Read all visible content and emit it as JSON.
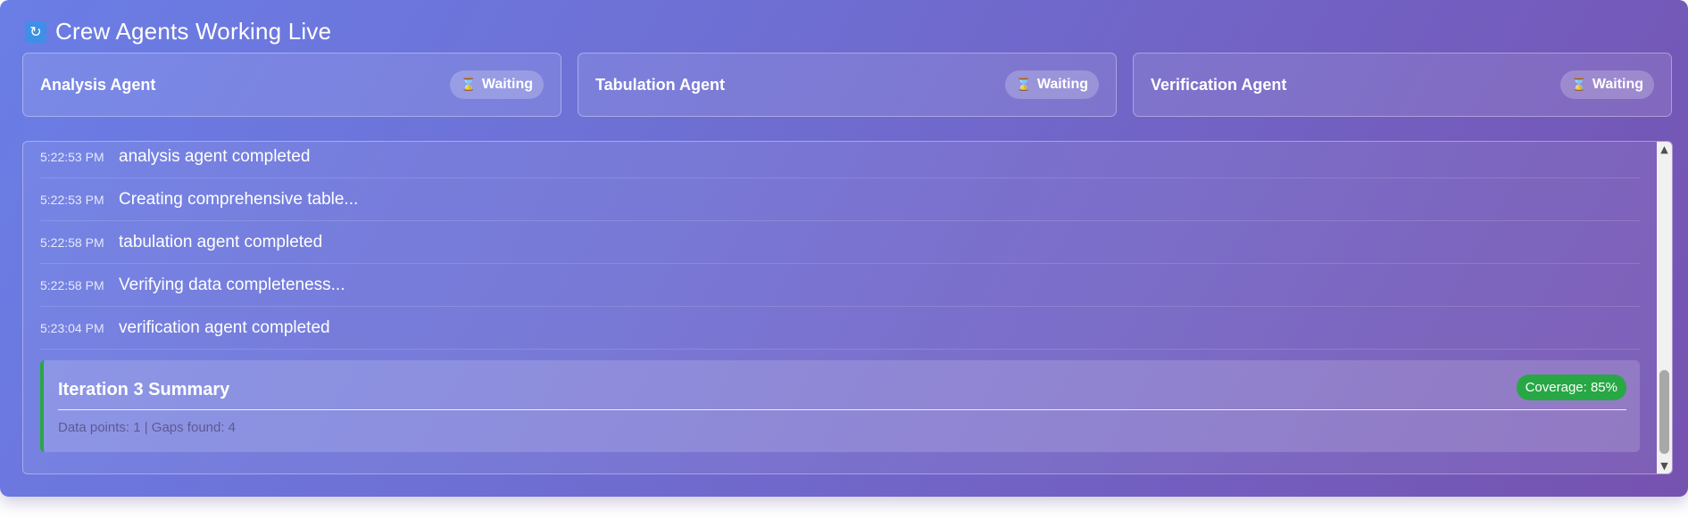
{
  "header": {
    "icon": "refresh-icon",
    "title": "Crew Agents Working Live"
  },
  "agents": [
    {
      "name": "Analysis Agent",
      "status": "Waiting",
      "status_icon": "hourglass-icon"
    },
    {
      "name": "Tabulation Agent",
      "status": "Waiting",
      "status_icon": "hourglass-icon"
    },
    {
      "name": "Verification Agent",
      "status": "Waiting",
      "status_icon": "hourglass-icon"
    }
  ],
  "log": {
    "entries": [
      {
        "time": "5:22:53 PM",
        "message": "analysis agent completed"
      },
      {
        "time": "5:22:53 PM",
        "message": "Creating comprehensive table..."
      },
      {
        "time": "5:22:58 PM",
        "message": "tabulation agent completed"
      },
      {
        "time": "5:22:58 PM",
        "message": "Verifying data completeness..."
      },
      {
        "time": "5:23:04 PM",
        "message": "verification agent completed"
      }
    ],
    "summary": {
      "title": "Iteration 3 Summary",
      "coverage": "Coverage: 85%",
      "stats": "Data points: 1 | Gaps found: 4"
    }
  },
  "colors": {
    "gradient_start": "#6a7ee6",
    "gradient_end": "#7652b0",
    "success": "#28a745"
  }
}
